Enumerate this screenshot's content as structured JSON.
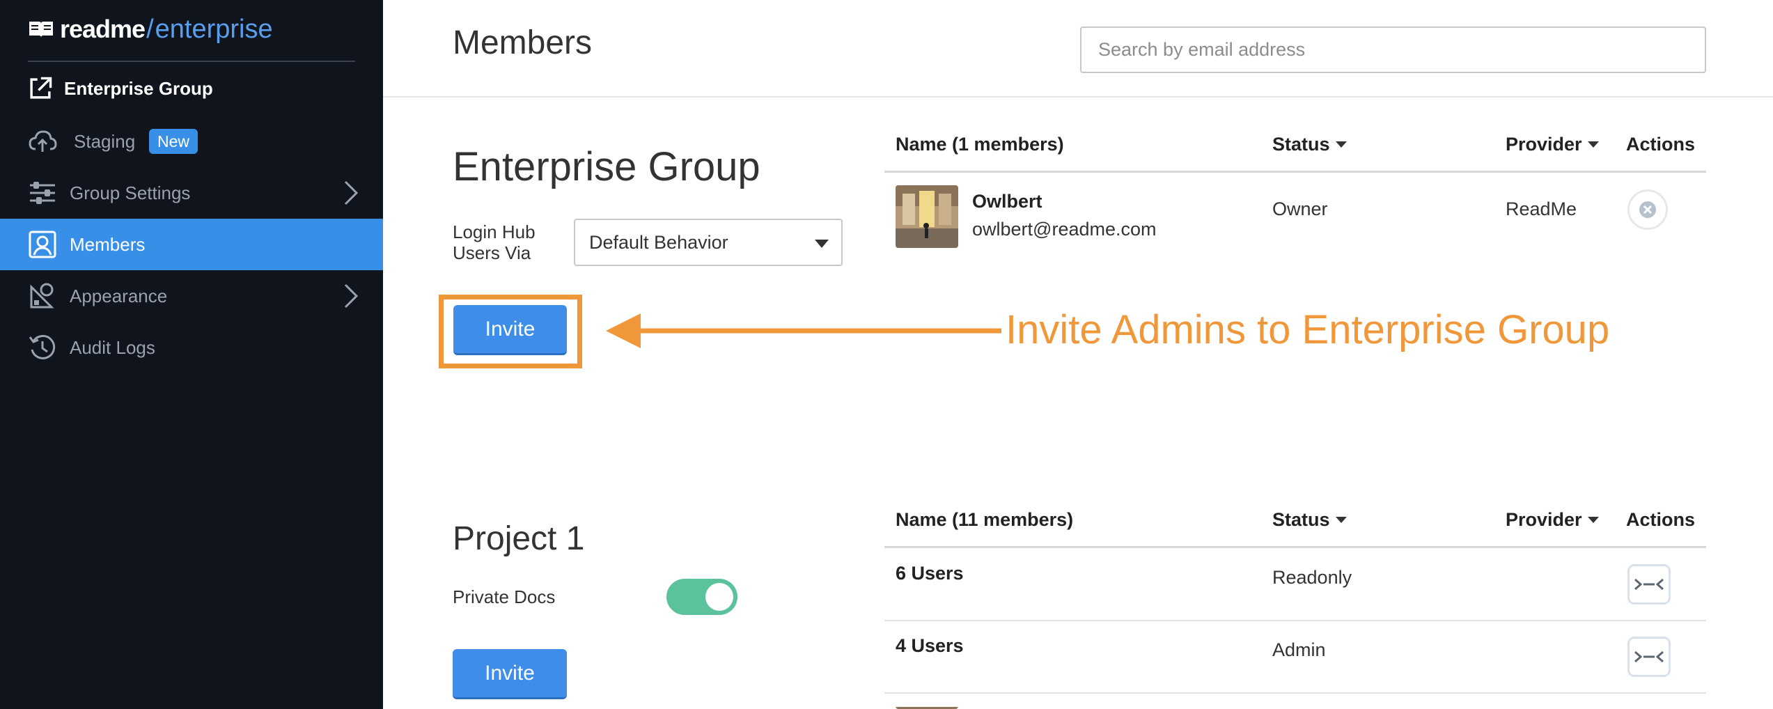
{
  "brand": {
    "name": "readme",
    "slash": "/",
    "suffix": "enterprise",
    "accent_color": "#378fe8"
  },
  "sidebar": {
    "group_label": "Enterprise Group",
    "items": [
      {
        "label": "Staging",
        "icon": "cloud-upload-icon",
        "badge": "New"
      },
      {
        "label": "Group Settings",
        "icon": "sliders-icon",
        "has_chevron": true
      },
      {
        "label": "Members",
        "icon": "user-card-icon",
        "active": true
      },
      {
        "label": "Appearance",
        "icon": "paint-icon",
        "has_chevron": true
      },
      {
        "label": "Audit Logs",
        "icon": "history-icon"
      }
    ]
  },
  "header": {
    "title": "Members",
    "search_placeholder": "Search by email address"
  },
  "enterprise_group": {
    "title": "Enterprise Group",
    "login_label_line1": "Login Hub",
    "login_label_line2": "Users Via",
    "login_value": "Default Behavior",
    "invite_label": "Invite",
    "table": {
      "col_name": "Name (1 members)",
      "col_status": "Status",
      "col_provider": "Provider",
      "col_actions": "Actions",
      "rows": [
        {
          "name": "Owlbert",
          "email": "owlbert@readme.com",
          "status": "Owner",
          "provider": "ReadMe"
        }
      ]
    }
  },
  "annotation": {
    "text": "Invite Admins to Enterprise Group",
    "color": "#f0973a"
  },
  "project": {
    "title": "Project 1",
    "private_docs_label": "Private Docs",
    "private_docs_on": true,
    "invite_label": "Invite",
    "table": {
      "col_name": "Name (11 members)",
      "col_status": "Status",
      "col_provider": "Provider",
      "col_actions": "Actions",
      "rows": [
        {
          "name": "6 Users",
          "status": "Readonly"
        },
        {
          "name": "4 Users",
          "status": "Admin"
        }
      ]
    }
  }
}
